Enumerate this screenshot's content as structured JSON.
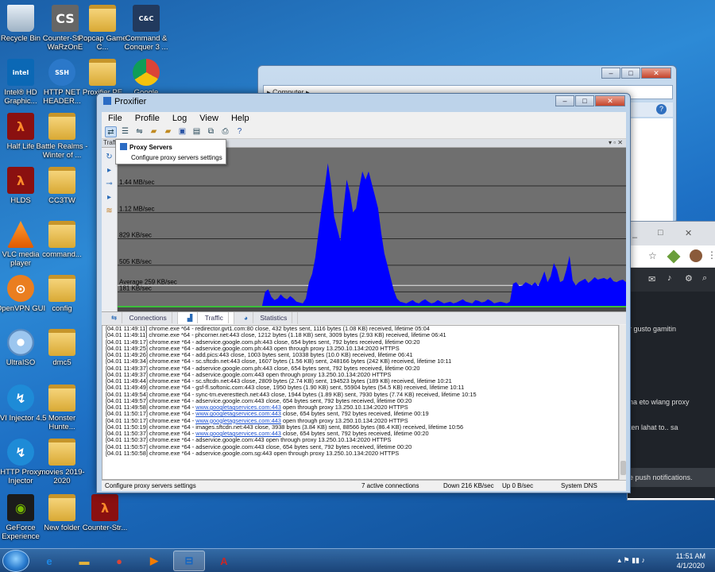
{
  "desktop": {
    "icons": [
      {
        "label": "Recycle Bin",
        "icon": "recycle-bin-icon"
      },
      {
        "label": "Counter-Str... WaRzOnE",
        "icon": "counter-strike-icon"
      },
      {
        "label": "Popcap Game C...",
        "icon": "folder-icon"
      },
      {
        "label": "Command & Conquer 3 ...",
        "icon": "command-conquer-icon"
      },
      {
        "label": "Intel® HD Graphic...",
        "icon": "intel-graphics-icon"
      },
      {
        "label": "HTTP NET HEADER...",
        "icon": "ssh-icon"
      },
      {
        "label": "Proxifier PE",
        "icon": "folder-icon"
      },
      {
        "label": "Google",
        "icon": "chrome-icon"
      },
      {
        "label": "Half Life",
        "icon": "half-life-icon"
      },
      {
        "label": "Battle Realms - Winter of ...",
        "icon": "folder-icon"
      },
      {
        "label": "HLDS",
        "icon": "half-life-icon"
      },
      {
        "label": "CC3TW",
        "icon": "folder-icon"
      },
      {
        "label": "VLC media player",
        "icon": "vlc-icon"
      },
      {
        "label": "command...",
        "icon": "folder-icon"
      },
      {
        "label": "OpenVPN GUI",
        "icon": "openvpn-icon"
      },
      {
        "label": "config",
        "icon": "folder-icon"
      },
      {
        "label": "UltraISO",
        "icon": "ultraiso-icon"
      },
      {
        "label": "dmc5",
        "icon": "folder-icon"
      },
      {
        "label": "SVI Injector 4.5",
        "icon": "injector-icon"
      },
      {
        "label": "Monster Hunte...",
        "icon": "folder-icon"
      },
      {
        "label": "HTTP Proxy Injector",
        "icon": "injector-icon"
      },
      {
        "label": "movies 2019-2020",
        "icon": "folder-icon"
      },
      {
        "label": "GeForce Experience",
        "icon": "nvidia-icon"
      },
      {
        "label": "New folder",
        "icon": "folder-icon"
      },
      {
        "label": "Counter-Str...",
        "icon": "half-life-icon"
      }
    ]
  },
  "explorer": {
    "address": "▸ Computer ▸"
  },
  "chrome_window": {
    "text1": "r gusto gamitin",
    "text2": "na eto wlang proxy",
    "text3": "ten lahat to.. sa",
    "text4": "e push notifications."
  },
  "proxifier": {
    "title": "Proxifier",
    "menu": [
      "File",
      "Profile",
      "Log",
      "View",
      "Help"
    ],
    "traffic_header": "Traffic",
    "tooltip": {
      "title": "Proxy Servers",
      "subtitle": "Configure proxy servers settings"
    },
    "tabs": [
      "Connections",
      "Traffic",
      "Statistics"
    ],
    "active_tab": "Traffic",
    "log_lines": [
      {
        "text": "[04.01 11:49:11] chrome.exe *64 - redirector.gvt1.com:80 close, 432 bytes sent, 1116 bytes (1.08 KB) received, lifetime 05:04"
      },
      {
        "text": "[04.01 11:49:11] chrome.exe *64 - phcorner.net:443 close, 1212 bytes (1.18 KB) sent, 3009 bytes (2.93 KB) received, lifetime 06:41"
      },
      {
        "text": "[04.01 11:49:17] chrome.exe *64 - adservice.google.com.ph:443 close, 654 bytes sent, 792 bytes received, lifetime 00:20"
      },
      {
        "text": "[04.01 11:49:25] chrome.exe *64 - adservice.google.com.ph:443 open through proxy 13.250.10.134:2020 HTTPS"
      },
      {
        "text": "[04.01 11:49:26] chrome.exe *64 - add.pics:443 close, 1003 bytes sent, 10338 bytes (10.0 KB) received, lifetime 06:41"
      },
      {
        "text": "[04.01 11:49:34] chrome.exe *64 - sc.sftcdn.net:443 close, 1607 bytes (1.56 KB) sent, 248166 bytes (242 KB) received, lifetime 10:11"
      },
      {
        "text": "[04.01 11:49:37] chrome.exe *64 - adservice.google.com.ph:443 close, 654 bytes sent, 792 bytes received, lifetime 00:20"
      },
      {
        "text": "[04.01 11:49:37] chrome.exe *64 - adservice.google.com:443 open through proxy 13.250.10.134:2020 HTTPS"
      },
      {
        "text": "[04.01 11:49:44] chrome.exe *64 - sc.sftcdn.net:443 close, 2809 bytes (2.74 KB) sent, 194523 bytes (189 KB) received, lifetime 10:21"
      },
      {
        "text": "[04.01 11:49:49] chrome.exe *64 - gsf-fl.softonic.com:443 close, 1950 bytes (1.90 KB) sent, 55904 bytes (54.5 KB) received, lifetime 10:11"
      },
      {
        "text": "[04.01 11:49:54] chrome.exe *64 - sync-tm.everesttech.net:443 close, 1944 bytes (1.89 KB) sent, 7930 bytes (7.74 KB) received, lifetime 10:15"
      },
      {
        "text": "[04.01 11:49:57] chrome.exe *64 - adservice.google.com:443 close, 654 bytes sent, 792 bytes received, lifetime 00:20"
      },
      {
        "pre": "[04.01 11:49:58] chrome.exe *64 - ",
        "link": "www.googletagservices.com:443",
        "post": " open through proxy 13.250.10.134:2020 HTTPS"
      },
      {
        "pre": "[04.01 11:50:17] chrome.exe *64 - ",
        "link": "www.googletagservices.com:443",
        "post": " close, 654 bytes sent, 792 bytes received, lifetime 00:19"
      },
      {
        "pre": "[04.01 11:50:17] chrome.exe *64 - ",
        "link": "www.googletagservices.com:443",
        "post": " open through proxy 13.250.10.134:2020 HTTPS"
      },
      {
        "text": "[04.01 11:50:19] chrome.exe *64 - images.sftcdn.net:443 close, 3938 bytes (3.84 KB) sent, 88566 bytes (86.4 KB) received, lifetime 10:56"
      },
      {
        "pre": "[04.01 11:50:37] chrome.exe *64 - ",
        "link": "www.googletagservices.com:443",
        "post": " close, 654 bytes sent, 792 bytes received, lifetime 00:20"
      },
      {
        "text": "[04.01 11:50:37] chrome.exe *64 - adservice.google.com:443 open through proxy 13.250.10.134:2020 HTTPS"
      },
      {
        "text": "[04.01 11:50:57] chrome.exe *64 - adservice.google.com:443 close, 654 bytes sent, 792 bytes received, lifetime 00:20"
      },
      {
        "text": "[04.01 11:50:58] chrome.exe *64 - adservice.google.com.sg:443 open through proxy 13.250.10.134:2020 HTTPS"
      }
    ],
    "status": {
      "message": "Configure proxy servers settings",
      "connections": "7 active connections",
      "down": "Down 216 KB/sec",
      "up": "Up 0 B/sec",
      "dns": "System DNS"
    }
  },
  "chart_data": {
    "type": "area",
    "title": "",
    "xlabel": "",
    "ylabel": "",
    "y_tick_labels": [
      "1.44 MB/sec",
      "1.12 MB/sec",
      "829 KB/sec",
      "505 KB/sec",
      "181 KB/sec"
    ],
    "y_ticks_kb": [
      1474,
      1147,
      829,
      505,
      181
    ],
    "average_label": "Average 259 KB/sec",
    "average_kb": 259,
    "ylim": [
      0,
      1900
    ],
    "series": [
      {
        "color": "#0000ff",
        "values": [
          0,
          0,
          0,
          0,
          0,
          0,
          0,
          0,
          0,
          0,
          0,
          0,
          0,
          0,
          0,
          0,
          0,
          0,
          0,
          0,
          0,
          0,
          0,
          0,
          0,
          0,
          0,
          0,
          0,
          0,
          0,
          0,
          0,
          0,
          0,
          0,
          0,
          0,
          0,
          0,
          0,
          0,
          0,
          0,
          0,
          0,
          0,
          180,
          210,
          120,
          80,
          100,
          150,
          110,
          90,
          130,
          100,
          60,
          50,
          40,
          100,
          300,
          400,
          600,
          900,
          1200,
          1450,
          1750,
          1500,
          1100,
          950,
          800,
          1200,
          1550,
          1400,
          1150,
          1200,
          1450,
          1650,
          1550,
          1650,
          1500,
          1350,
          1200,
          900,
          650,
          500,
          350,
          200,
          100,
          60,
          50,
          40,
          60,
          80,
          50,
          40,
          70,
          90,
          60,
          40,
          50,
          80,
          60,
          40,
          50,
          60,
          40,
          50,
          70,
          90,
          60,
          50,
          40,
          80,
          70,
          50,
          60,
          90,
          70,
          40,
          50,
          60,
          50,
          40,
          60,
          280,
          300,
          250,
          260,
          300,
          280,
          260,
          300,
          250,
          330,
          430,
          300,
          370,
          530,
          450,
          300,
          320,
          450,
          620,
          320,
          260,
          300,
          320,
          340,
          290,
          320,
          360,
          330,
          340,
          350,
          330,
          360,
          310,
          300,
          320,
          330,
          300
        ]
      }
    ],
    "grid": true
  },
  "taskbar": {
    "apps": [
      {
        "name": "ie-icon",
        "label": "e",
        "color": "#1e88e5"
      },
      {
        "name": "explorer-folder-icon",
        "label": "▬",
        "color": "#e3b23c"
      },
      {
        "name": "chrome-taskbar-icon",
        "label": "●",
        "color": "#db4437"
      },
      {
        "name": "media-player-icon",
        "label": "▶",
        "color": "#f57c00"
      },
      {
        "name": "proxifier-taskbar-icon",
        "label": "⊟",
        "color": "#1565c0"
      },
      {
        "name": "acrobat-icon",
        "label": "A",
        "color": "#c62828"
      }
    ],
    "time": "11:51 AM",
    "date": "4/1/2020"
  }
}
